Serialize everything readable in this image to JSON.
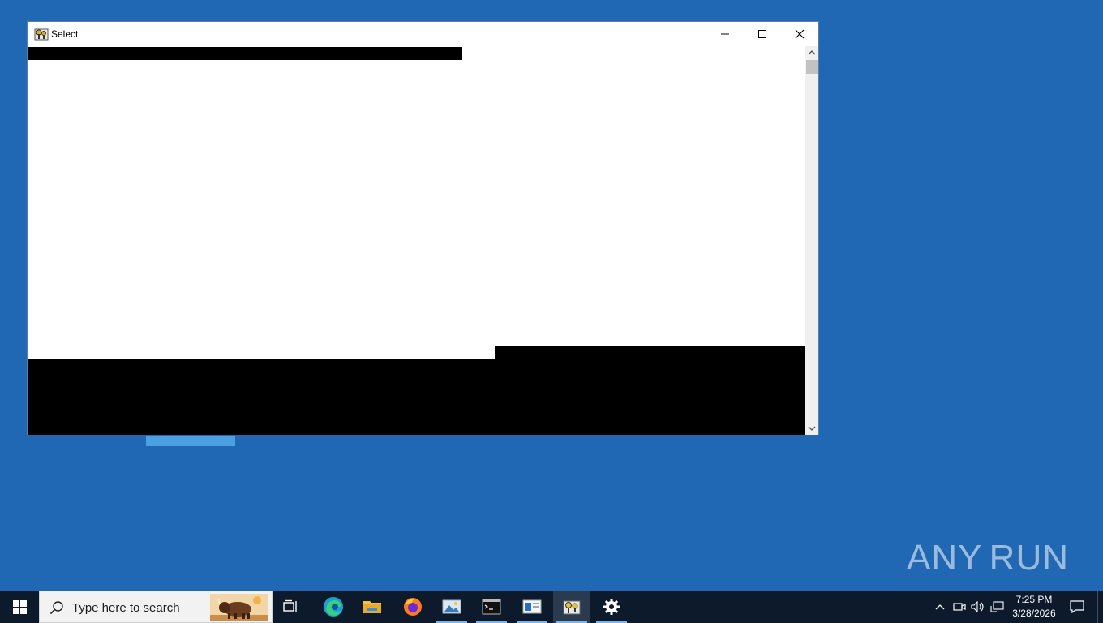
{
  "window": {
    "title": "Select",
    "controls": {
      "minimize": "minimize",
      "maximize": "maximize",
      "close": "close"
    }
  },
  "taskbar": {
    "search_placeholder": "Type here to search",
    "pinned": [
      {
        "name": "task-view",
        "icon": "task-view-icon"
      },
      {
        "name": "edge",
        "icon": "edge-icon"
      },
      {
        "name": "file-explorer",
        "icon": "folder-icon"
      },
      {
        "name": "firefox",
        "icon": "firefox-icon"
      },
      {
        "name": "photos",
        "icon": "photos-icon"
      },
      {
        "name": "command-prompt",
        "icon": "terminal-icon"
      },
      {
        "name": "window-app",
        "icon": "window-app-icon"
      },
      {
        "name": "key-manager",
        "icon": "keys-icon"
      },
      {
        "name": "settings",
        "icon": "gear-icon"
      }
    ],
    "clock": {
      "time": "7:25 PM",
      "date": "3/28/2026"
    }
  },
  "watermark": {
    "left": "ANY",
    "right": "RUN"
  },
  "colors": {
    "desktop": "#2168b4",
    "taskbar": "#0c1a2b",
    "accent": "#7fb2e5"
  }
}
